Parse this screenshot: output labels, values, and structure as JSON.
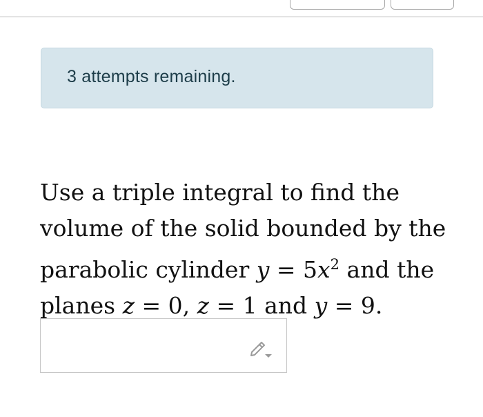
{
  "alert": {
    "message": "3 attempts remaining."
  },
  "question": {
    "line1": "Use a triple integral to find the",
    "line2": "volume of the solid bounded by the",
    "line3_prefix": "parabolic cylinder ",
    "line3_var_y": "y",
    "line3_eq": " = 5",
    "line3_var_x": "x",
    "line3_exp": "2",
    "line3_suffix": " and the",
    "line4_prefix": "planes ",
    "line4_var_z1": "z",
    "line4_eq1": " = 0, ",
    "line4_var_z2": "z",
    "line4_eq2": " = 1 and ",
    "line4_var_y": "y",
    "line4_eq3": " = 9."
  },
  "answer": {
    "value": "",
    "editor_icon": "pencil-dropdown-icon"
  },
  "colors": {
    "alert_bg": "#d6e5ec",
    "alert_text": "#1d3d49",
    "border": "#c7c7c7",
    "icon": "#9a9a9a"
  }
}
